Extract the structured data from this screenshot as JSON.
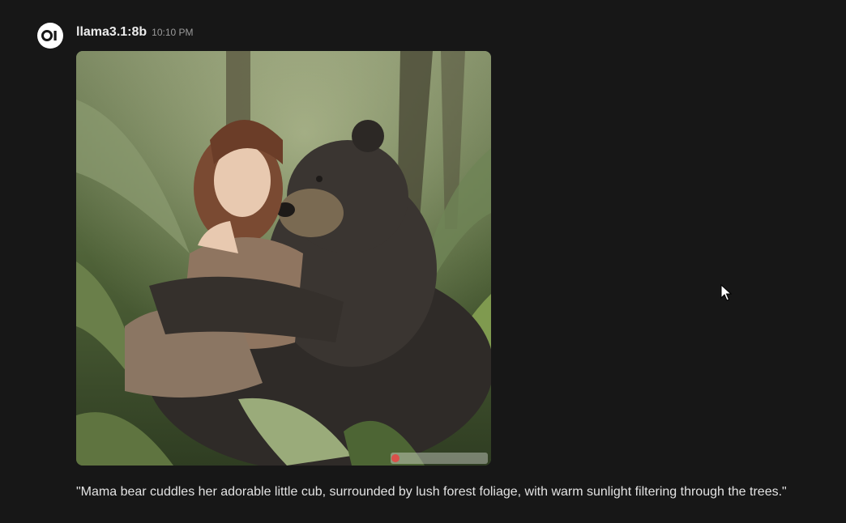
{
  "message": {
    "avatar_icon": "ollama-logo-icon",
    "model_name": "llama3.1:8b",
    "timestamp": "10:10 PM",
    "image_alt": "Generated image: woman embracing a black bear in a lush green jungle",
    "caption": "\"Mama bear cuddles her adorable little cub, surrounded by lush forest foliage, with warm sunlight filtering through the trees.\""
  },
  "colors": {
    "background": "#171717",
    "text_primary": "#ececec",
    "text_secondary": "#9b9b9b"
  }
}
